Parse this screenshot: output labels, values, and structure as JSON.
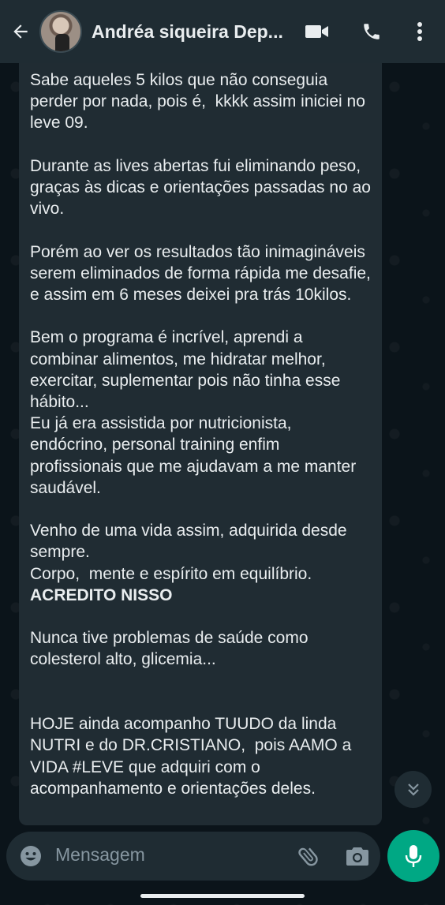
{
  "header": {
    "contact_name": "Andréa siqueira Dep...",
    "icons": [
      "back-arrow-icon",
      "video-call-icon",
      "voice-call-icon",
      "more-options-icon"
    ]
  },
  "message": {
    "paragraphs": [
      "Sabe aqueles 5 kilos que não conseguia perder por nada, pois é,  kkkk assim iniciei no leve 09.",
      "Durante as lives abertas fui eliminando peso, graças às dicas e orientações passadas no ao vivo.",
      "Porém ao ver os resultados tão inimagináveis serem eliminados de forma rápida me desafie, e assim em 6 meses deixei pra trás 10kilos.",
      "Bem o programa é incrível, aprendi a combinar alimentos, me hidratar melhor, exercitar, suplementar pois não tinha esse hábito...",
      "Eu já era assistida por nutricionista, endócrino, personal training enfim profissionais que me ajudavam a me manter saudável.",
      "Venho de uma vida assim, adquirida desde sempre.",
      "Corpo,  mente e espírito em equilíbrio.",
      "ACREDITO NISSO",
      "Nunca tive problemas de saúde como colesterol alto, glicemia...",
      "HOJE ainda acompanho TUUDO da linda NUTRI e do DR.CRISTIANO,  pois AAMO a VIDA #LEVE que adquiri com o acompanhamento e orientações deles."
    ]
  },
  "composer": {
    "placeholder": "Mensagem"
  },
  "colors": {
    "header_bg": "#1f2c33",
    "bubble_bg": "#202c33",
    "chat_bg": "#0b141a",
    "accent": "#00a884",
    "text": "#e9edef",
    "muted": "#8696a0"
  }
}
